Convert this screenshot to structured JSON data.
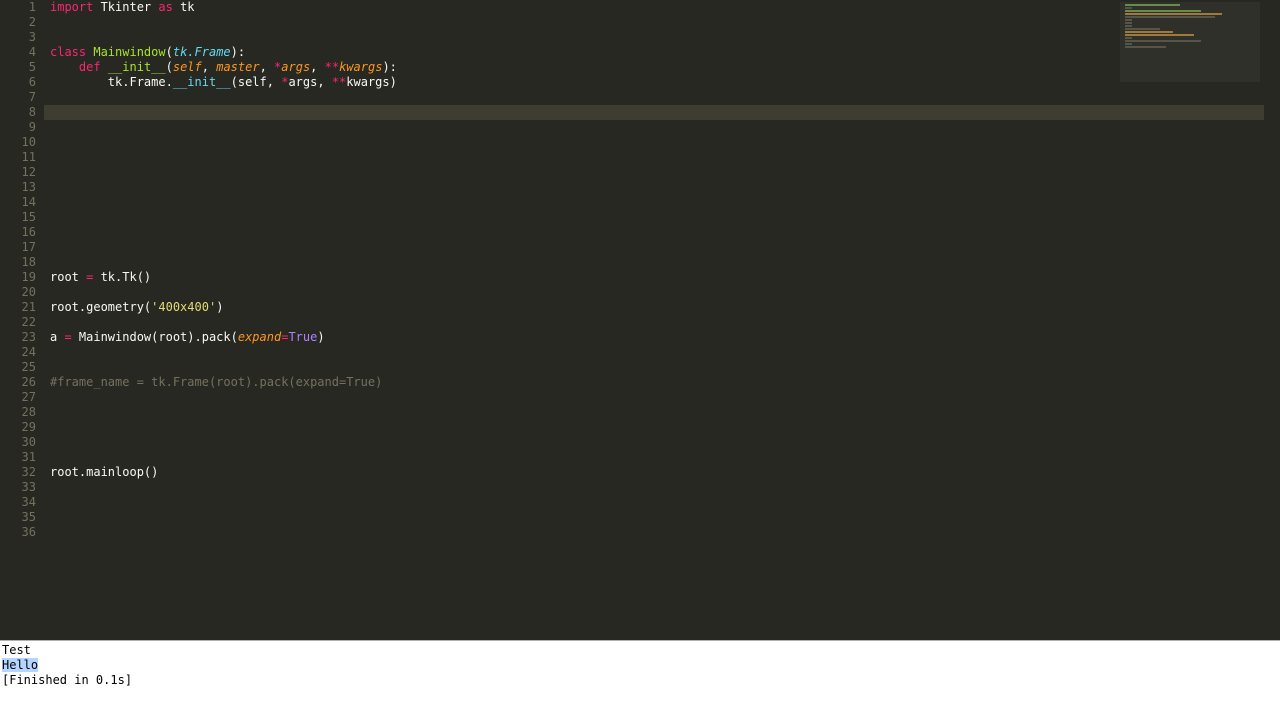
{
  "editor": {
    "gutter_start": 1,
    "gutter_end": 36,
    "active_line": 8,
    "lines": {
      "l1": [
        [
          "import",
          "kw"
        ],
        [
          " Tkinter ",
          "pn"
        ],
        [
          "as",
          "kw"
        ],
        [
          " tk",
          "pn"
        ]
      ],
      "l2": [
        [
          "",
          "pn"
        ]
      ],
      "l3": [
        [
          "",
          "pn"
        ]
      ],
      "l4": [
        [
          "class",
          "kw"
        ],
        [
          " ",
          "pn"
        ],
        [
          "Mainwindow",
          "name"
        ],
        [
          "(",
          "pn"
        ],
        [
          "tk.Frame",
          "kw2"
        ],
        [
          "):",
          "pn"
        ]
      ],
      "l5": [
        [
          "    ",
          "pn"
        ],
        [
          "def",
          "kw"
        ],
        [
          " ",
          "pn"
        ],
        [
          "__init__",
          "name"
        ],
        [
          "(",
          "pn"
        ],
        [
          "self",
          "arg"
        ],
        [
          ", ",
          "pn"
        ],
        [
          "master",
          "arg"
        ],
        [
          ", ",
          "pn"
        ],
        [
          "*",
          "op"
        ],
        [
          "args",
          "arg"
        ],
        [
          ", ",
          "pn"
        ],
        [
          "**",
          "op"
        ],
        [
          "kwargs",
          "arg"
        ],
        [
          "):",
          "pn"
        ]
      ],
      "l6": [
        [
          "        tk.Frame.",
          "pn"
        ],
        [
          "__init__",
          "fn"
        ],
        [
          "(self, ",
          "pn"
        ],
        [
          "*",
          "op"
        ],
        [
          "args, ",
          "pn"
        ],
        [
          "**",
          "op"
        ],
        [
          "kwargs)",
          "pn"
        ]
      ],
      "l7": [
        [
          "",
          "pn"
        ]
      ],
      "l8": [
        [
          "        ",
          "pn"
        ]
      ],
      "l9": [
        [
          "",
          "pn"
        ]
      ],
      "l10": [
        [
          "",
          "pn"
        ]
      ],
      "l11": [
        [
          "",
          "pn"
        ]
      ],
      "l12": [
        [
          "",
          "pn"
        ]
      ],
      "l13": [
        [
          "",
          "pn"
        ]
      ],
      "l14": [
        [
          "",
          "pn"
        ]
      ],
      "l15": [
        [
          "",
          "pn"
        ]
      ],
      "l16": [
        [
          "",
          "pn"
        ]
      ],
      "l17": [
        [
          "",
          "pn"
        ]
      ],
      "l18": [
        [
          "",
          "pn"
        ]
      ],
      "l19": [
        [
          "root ",
          "pn"
        ],
        [
          "=",
          "op"
        ],
        [
          " tk.Tk()",
          "pn"
        ]
      ],
      "l20": [
        [
          "",
          "pn"
        ]
      ],
      "l21": [
        [
          "root.geometry(",
          "pn"
        ],
        [
          "'400x400'",
          "str"
        ],
        [
          ")",
          "pn"
        ]
      ],
      "l22": [
        [
          "",
          "pn"
        ]
      ],
      "l23": [
        [
          "a ",
          "pn"
        ],
        [
          "=",
          "op"
        ],
        [
          " Mainwindow(root).pack(",
          "pn"
        ],
        [
          "expand",
          "arg"
        ],
        [
          "=",
          "op"
        ],
        [
          "True",
          "num"
        ],
        [
          ")",
          "pn"
        ]
      ],
      "l24": [
        [
          "",
          "pn"
        ]
      ],
      "l25": [
        [
          "",
          "pn"
        ]
      ],
      "l26": [
        [
          "#frame_name = tk.Frame(root).pack(expand=True)",
          "cmt"
        ]
      ],
      "l27": [
        [
          "",
          "pn"
        ]
      ],
      "l28": [
        [
          "",
          "pn"
        ]
      ],
      "l29": [
        [
          "",
          "pn"
        ]
      ],
      "l30": [
        [
          "",
          "pn"
        ]
      ],
      "l31": [
        [
          "",
          "pn"
        ]
      ],
      "l32": [
        [
          "root.mainloop()",
          "pn"
        ]
      ],
      "l33": [
        [
          "",
          "pn"
        ]
      ],
      "l34": [
        [
          "",
          "pn"
        ]
      ],
      "l35": [
        [
          "",
          "pn"
        ]
      ],
      "l36": [
        [
          "",
          "pn"
        ]
      ]
    }
  },
  "output": {
    "line1": "Test",
    "line2": "Hello",
    "line3": "[Finished in 0.1s]"
  }
}
